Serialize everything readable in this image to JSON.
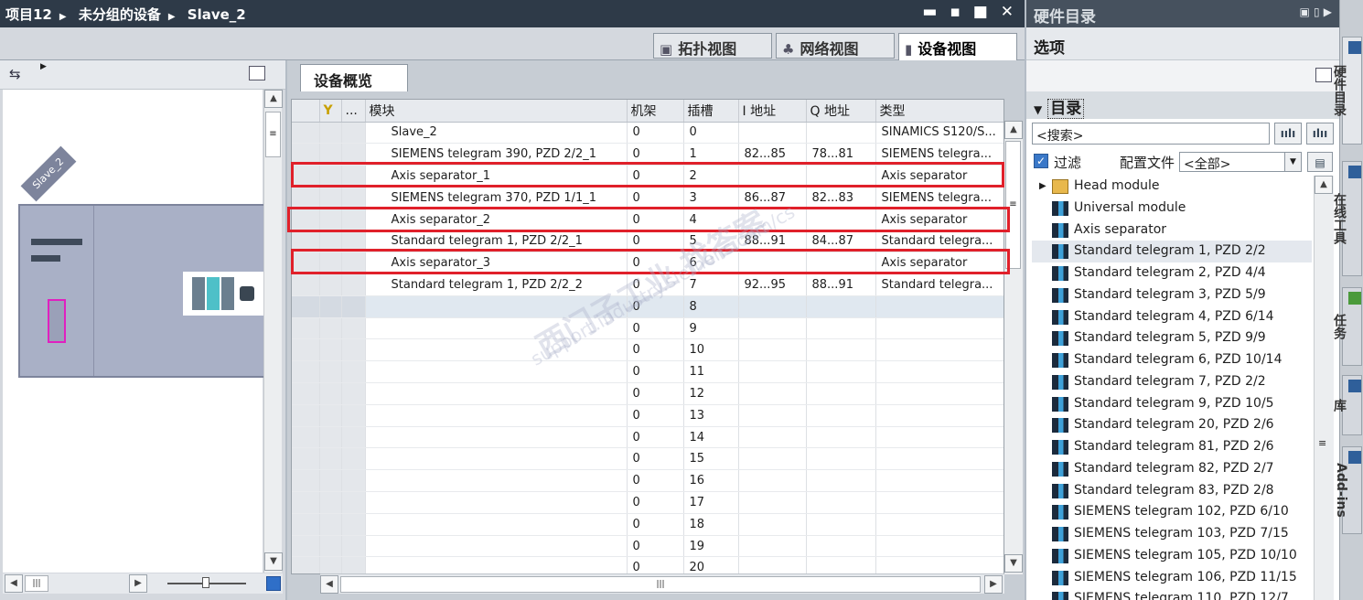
{
  "titlebar": {
    "crumbs": [
      "项目12",
      "未分组的设备",
      "Slave_2"
    ],
    "window_buttons": "▬ ▪ ■ ✕"
  },
  "view_tabs": {
    "topology": "拓扑视图",
    "network": "网络视图",
    "device": "设备视图"
  },
  "device_view": {
    "slave_label": "Slave_2"
  },
  "overview": {
    "tab_label": "设备概览",
    "columns": [
      "",
      "...",
      "模块",
      "机架",
      "插槽",
      "I 地址",
      "Q 地址",
      "类型"
    ],
    "rows": [
      {
        "module": "Slave_2",
        "rack": "0",
        "slot": "0",
        "i_addr": "",
        "q_addr": "",
        "type": "SINAMICS S120/S..."
      },
      {
        "module": "SIEMENS telegram 390, PZD 2/2_1",
        "rack": "0",
        "slot": "1",
        "i_addr": "82...85",
        "q_addr": "78...81",
        "type": "SIEMENS telegra..."
      },
      {
        "module": "Axis separator_1",
        "rack": "0",
        "slot": "2",
        "i_addr": "",
        "q_addr": "",
        "type": "Axis separator"
      },
      {
        "module": "SIEMENS telegram 370, PZD 1/1_1",
        "rack": "0",
        "slot": "3",
        "i_addr": "86...87",
        "q_addr": "82...83",
        "type": "SIEMENS telegra..."
      },
      {
        "module": "Axis separator_2",
        "rack": "0",
        "slot": "4",
        "i_addr": "",
        "q_addr": "",
        "type": "Axis separator"
      },
      {
        "module": "Standard telegram 1, PZD 2/2_1",
        "rack": "0",
        "slot": "5",
        "i_addr": "88...91",
        "q_addr": "84...87",
        "type": "Standard telegra..."
      },
      {
        "module": "Axis separator_3",
        "rack": "0",
        "slot": "6",
        "i_addr": "",
        "q_addr": "",
        "type": "Axis separator"
      },
      {
        "module": "Standard telegram 1, PZD 2/2_2",
        "rack": "0",
        "slot": "7",
        "i_addr": "92...95",
        "q_addr": "88...91",
        "type": "Standard telegra..."
      },
      {
        "module": "",
        "rack": "0",
        "slot": "8",
        "i_addr": "",
        "q_addr": "",
        "type": ""
      },
      {
        "module": "",
        "rack": "0",
        "slot": "9",
        "i_addr": "",
        "q_addr": "",
        "type": ""
      },
      {
        "module": "",
        "rack": "0",
        "slot": "10",
        "i_addr": "",
        "q_addr": "",
        "type": ""
      },
      {
        "module": "",
        "rack": "0",
        "slot": "11",
        "i_addr": "",
        "q_addr": "",
        "type": ""
      },
      {
        "module": "",
        "rack": "0",
        "slot": "12",
        "i_addr": "",
        "q_addr": "",
        "type": ""
      },
      {
        "module": "",
        "rack": "0",
        "slot": "13",
        "i_addr": "",
        "q_addr": "",
        "type": ""
      },
      {
        "module": "",
        "rack": "0",
        "slot": "14",
        "i_addr": "",
        "q_addr": "",
        "type": ""
      },
      {
        "module": "",
        "rack": "0",
        "slot": "15",
        "i_addr": "",
        "q_addr": "",
        "type": ""
      },
      {
        "module": "",
        "rack": "0",
        "slot": "16",
        "i_addr": "",
        "q_addr": "",
        "type": ""
      },
      {
        "module": "",
        "rack": "0",
        "slot": "17",
        "i_addr": "",
        "q_addr": "",
        "type": ""
      },
      {
        "module": "",
        "rack": "0",
        "slot": "18",
        "i_addr": "",
        "q_addr": "",
        "type": ""
      },
      {
        "module": "",
        "rack": "0",
        "slot": "19",
        "i_addr": "",
        "q_addr": "",
        "type": ""
      },
      {
        "module": "",
        "rack": "0",
        "slot": "20",
        "i_addr": "",
        "q_addr": "",
        "type": ""
      }
    ],
    "highlight_color": "#e0202a"
  },
  "watermark": {
    "line1": "西门子工业 找答案",
    "line2": "support.industry.siemens.com/cs"
  },
  "catalog": {
    "title": "硬件目录",
    "options_label": "选项",
    "directory_label": "目录",
    "search_placeholder": "<搜索>",
    "filter_label": "过滤",
    "profile_label": "配置文件",
    "profile_value": "<全部>",
    "items": [
      "Head module",
      "Universal module",
      "Axis separator",
      "Standard telegram 1, PZD 2/2",
      "Standard telegram 2, PZD 4/4",
      "Standard telegram 3, PZD 5/9",
      "Standard telegram 4, PZD 6/14",
      "Standard telegram 5, PZD 9/9",
      "Standard telegram 6, PZD 10/14",
      "Standard telegram 7, PZD 2/2",
      "Standard telegram 9, PZD 10/5",
      "Standard telegram 20, PZD 2/6",
      "Standard telegram 81, PZD 2/6",
      "Standard telegram 82, PZD 2/7",
      "Standard telegram 83, PZD 2/8",
      "SIEMENS telegram 102, PZD 6/10",
      "SIEMENS telegram 103, PZD 7/15",
      "SIEMENS telegram 105, PZD 10/10",
      "SIEMENS telegram 106, PZD 11/15",
      "SIEMENS telegram 110, PZD 12/7"
    ],
    "selected_index": 3
  },
  "side_tabs": [
    "硬件目录",
    "在线工具",
    "任务",
    "库",
    "Add-ins"
  ]
}
